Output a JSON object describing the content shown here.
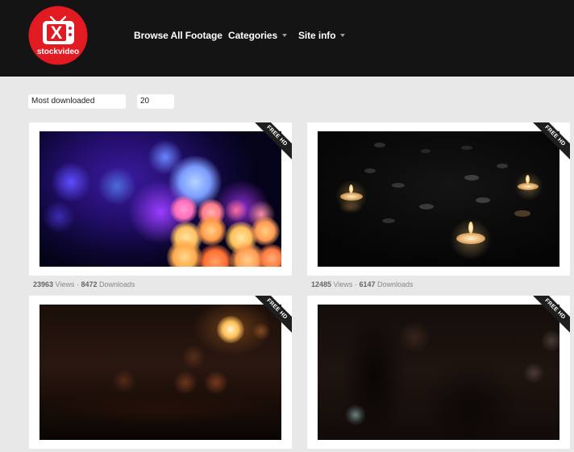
{
  "brand": {
    "logo_letter": "X",
    "logo_text": "stockvideo",
    "accent": "#e21b23"
  },
  "nav": {
    "browse": "Browse All Footage",
    "categories": "Categories",
    "site_info": "Site info"
  },
  "controls": {
    "sort": "Most downloaded",
    "per_page": "20"
  },
  "videos": [
    {
      "badge": "FREE HD",
      "views": "23963",
      "views_label": "Views",
      "separator": "·",
      "downloads": "8472",
      "downloads_label": "Downloads"
    },
    {
      "badge": "FREE HD",
      "views": "12485",
      "views_label": "Views",
      "separator": "·",
      "downloads": "6147",
      "downloads_label": "Downloads"
    },
    {
      "badge": "FREE HD"
    },
    {
      "badge": "FREE HD"
    }
  ]
}
